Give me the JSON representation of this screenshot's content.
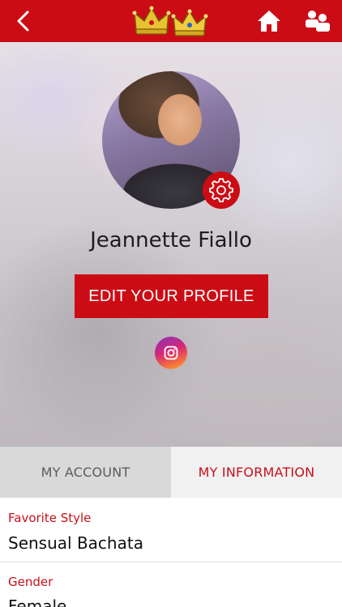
{
  "app": {
    "accent_color": "#cc0c15"
  },
  "topbar": {
    "back_icon": "chevron-left-icon",
    "logo_icon": "crowns-logo-icon",
    "home_icon": "home-icon",
    "people_icon": "users-icon"
  },
  "profile": {
    "name": "Jeannette Fiallo",
    "edit_button_label": "EDIT YOUR PROFILE",
    "settings_icon": "gear-icon",
    "social_icon": "instagram-icon"
  },
  "tabs": [
    {
      "label": "MY ACCOUNT",
      "active": false
    },
    {
      "label": "MY INFORMATION",
      "active": true
    }
  ],
  "fields": [
    {
      "label": "Favorite Style",
      "value": "Sensual Bachata"
    },
    {
      "label": "Gender",
      "value": "Female"
    }
  ]
}
